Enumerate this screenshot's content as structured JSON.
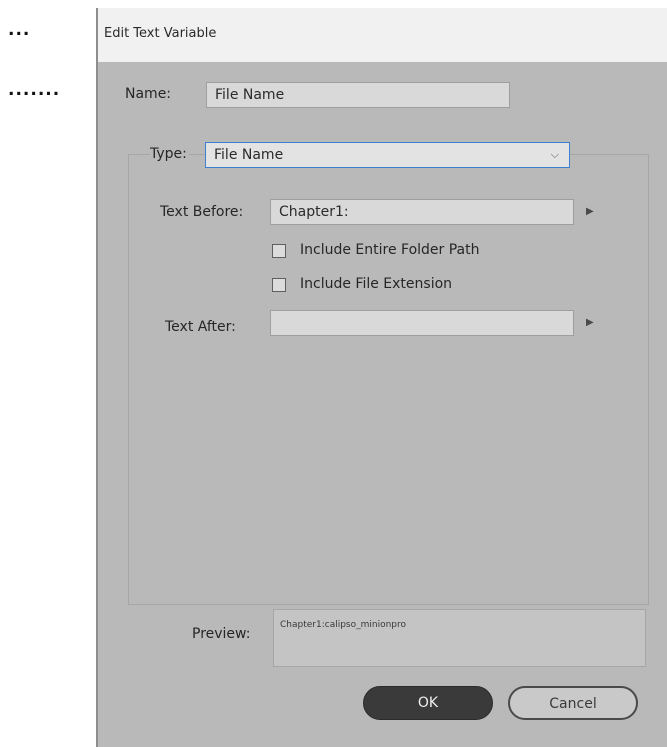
{
  "outside": {
    "ellipsis_1": "...",
    "ellipsis_2": "......."
  },
  "dialog": {
    "title": "Edit Text Variable",
    "name_label": "Name:",
    "name_value": "File Name",
    "type_label": "Type:",
    "type_value": "File Name",
    "text_before_label": "Text Before:",
    "text_before_value": "Chapter1:",
    "include_folder_label": "Include Entire Folder Path",
    "include_folder_checked": false,
    "include_extension_label": "Include File Extension",
    "include_extension_checked": false,
    "text_after_label": "Text After:",
    "text_after_value": "",
    "preview_label": "Preview:",
    "preview_value": "Chapter1:calipso_minionpro",
    "ok_label": "OK",
    "cancel_label": "Cancel"
  },
  "icons": {
    "dropdown": "chevron-down-icon",
    "insert_menu": "triangle-right-icon"
  },
  "colors": {
    "dialog_bg": "#b9b9b9",
    "focus_border": "#3f7fd2",
    "ok_button": "#3a3a3a"
  }
}
